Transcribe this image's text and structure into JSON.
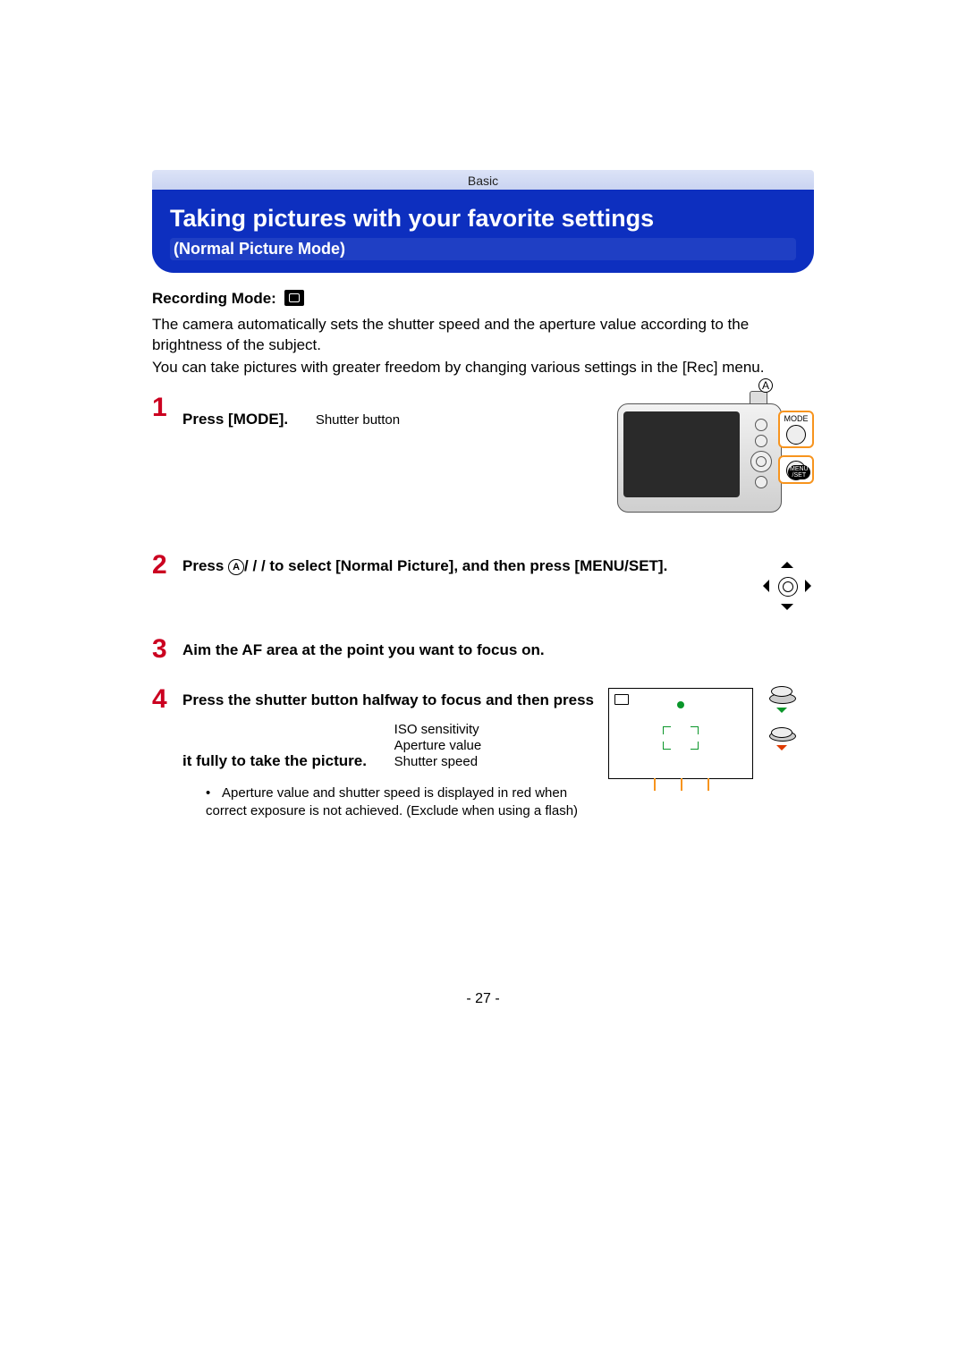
{
  "top_bar": "Basic",
  "title": "Taking pictures with your favorite settings",
  "subtitle": "(Normal Picture Mode)",
  "rec_mode_label": "Recording Mode:",
  "intro_p1": "The camera automatically sets the shutter speed and the aperture value according to the brightness of the subject.",
  "intro_p2": "You can take pictures with greater freedom by changing various settings in the [Rec] menu.",
  "steps": {
    "s1": {
      "num": "1",
      "text": "Press [MODE].",
      "label": "Shutter button",
      "callout_A": "A",
      "mode_label": "MODE",
      "menuset_label": "MENU\n/SET"
    },
    "s2": {
      "num": "2",
      "prefix": "Press ",
      "letter": "A",
      "mid": "/    /    /     to select [Normal Picture], and then press [MENU/SET]."
    },
    "s3": {
      "num": "3",
      "text": "Aim the AF area at the point you want to focus on."
    },
    "s4": {
      "num": "4",
      "text": "Press the shutter button halfway to focus and then press it fully to take the picture.",
      "labels": {
        "a": "ISO sensitivity",
        "b": "Aperture value",
        "c": "Shutter speed"
      },
      "note": "Aperture value and shutter speed is displayed in red when correct exposure is not achieved. (Exclude when using a flash)"
    }
  },
  "page_num": "- 27 -"
}
